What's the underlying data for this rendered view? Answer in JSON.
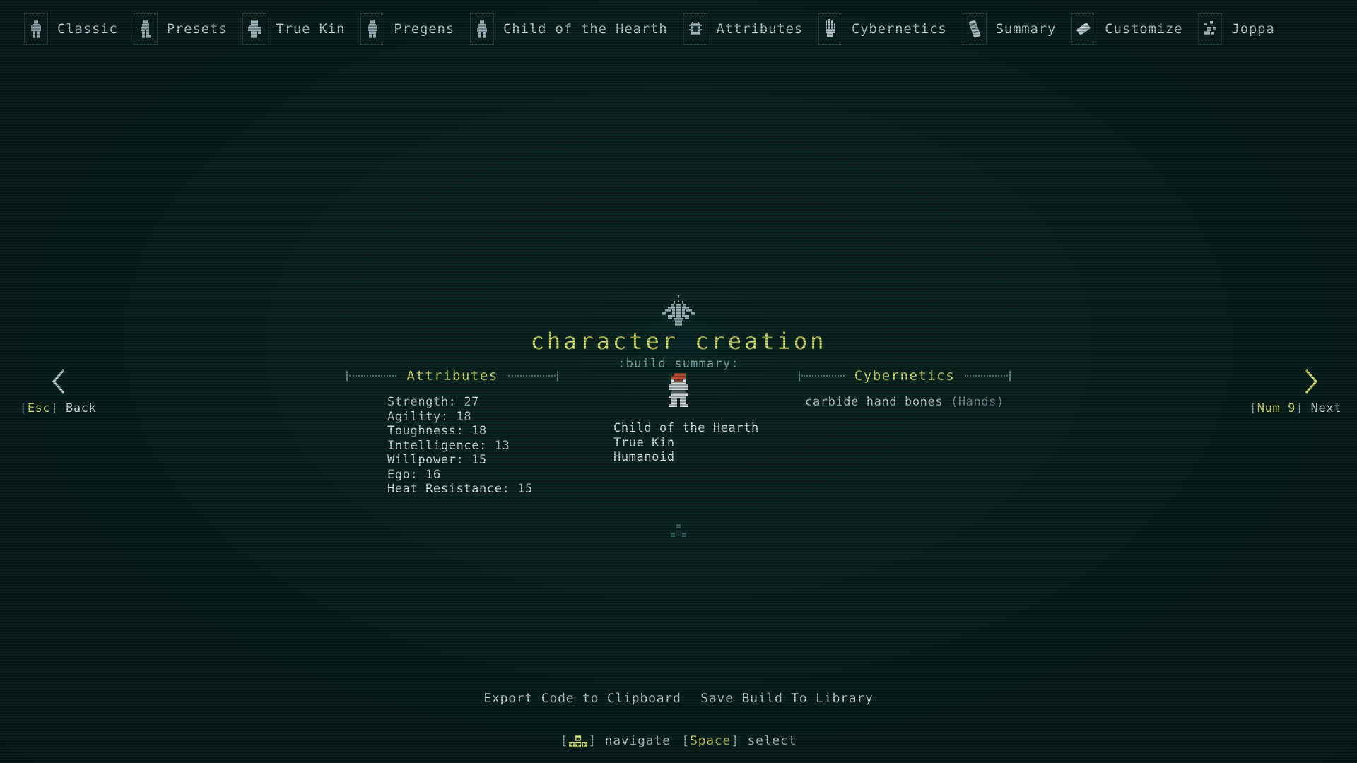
{
  "app": {
    "title": "character creation",
    "subtitle": ":build summary:",
    "background_color": "#0a2320",
    "accent_color": "#d7e06a",
    "text_color": "#cfe0e0",
    "muted_color": "#7f9c9c"
  },
  "tabs": [
    {
      "label": "Classic",
      "icon": "classic-figure-icon"
    },
    {
      "label": "Presets",
      "icon": "presets-figure-icon"
    },
    {
      "label": "True Kin",
      "icon": "true-kin-figure-icon"
    },
    {
      "label": "Pregens",
      "icon": "pregens-figure-icon"
    },
    {
      "label": "Child of the Hearth",
      "icon": "child-of-the-hearth-figure-icon"
    },
    {
      "label": "Attributes",
      "icon": "attributes-chip-icon"
    },
    {
      "label": "Cybernetics",
      "icon": "cybernetics-hand-icon"
    },
    {
      "label": "Summary",
      "icon": "summary-scroll-icon"
    },
    {
      "label": "Customize",
      "icon": "customize-gem-icon"
    },
    {
      "label": "Joppa",
      "icon": "joppa-map-icon"
    }
  ],
  "panels": {
    "attributes": {
      "title": "Attributes",
      "rows": [
        "Strength: 27",
        "Agility: 18",
        "Toughness: 18",
        "Intelligence: 13",
        "Willpower: 15",
        "Ego: 16",
        "Heat Resistance: 15"
      ]
    },
    "cybernetics": {
      "title": "Cybernetics",
      "implants": [
        {
          "name": "carbide hand bones",
          "slot": "(Hands)"
        }
      ]
    },
    "character": {
      "sprite_name": "player-character-sprite",
      "lines": [
        "Child of the Hearth",
        "True Kin",
        "Humanoid"
      ]
    }
  },
  "nav": {
    "back": {
      "key": "Esc",
      "label": "Back",
      "icon": "chevron-left-icon"
    },
    "next": {
      "key": "Num 9",
      "label": "Next",
      "icon": "chevron-right-icon"
    }
  },
  "actions": [
    "Export Code to Clipboard",
    "Save Build To Library"
  ],
  "footer": {
    "navigate_key": "arrow-keys-glyph",
    "navigate_label": "navigate",
    "select_key": "Space",
    "select_label": "select"
  }
}
